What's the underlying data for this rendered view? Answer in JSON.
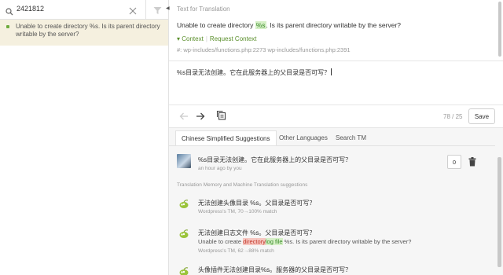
{
  "search": {
    "query": "2421812"
  },
  "strings": [
    {
      "text": "Unable to create directory %s. Is its parent directory writable by the server?"
    }
  ],
  "editor": {
    "section_label": "Text for Translation",
    "source_before": "Unable to create directory ",
    "source_placeholder": "%s",
    "source_after": ". Is its parent directory writable by the server?",
    "context_label": "Context",
    "request_context": "Request Context",
    "references": "#: wp-includes/functions.php:2273 wp-includes/functions.php:2391",
    "translation": "%s目录无法创建。它在此服务器上的父目录是否可写？",
    "counter": "78 / 25",
    "save_label": "Save"
  },
  "tabs": [
    {
      "label": "Chinese Simplified Suggestions"
    },
    {
      "label": "Other Languages"
    },
    {
      "label": "Search TM"
    }
  ],
  "suggestion": {
    "text": "%s目录无法创建。它在此服务器上的父目录是否可写？",
    "meta": "an hour ago by you",
    "votes": "0"
  },
  "tm": {
    "header": "Translation Memory and Machine Translation suggestions",
    "items": [
      {
        "text": "无法创建头像目录 %s。父目录是否可写？",
        "meta": "Wordpress's TM, 70→100% match"
      },
      {
        "text": "无法创建日志文件 %s。父目录是否可写？",
        "orig_before": "Unable to create ",
        "orig_del": "directory",
        "orig_ins": "log file",
        "orig_after": " %s. Is its parent directory writable by the server?",
        "meta": "Wordpress's TM, 62→88% match"
      },
      {
        "text": "头像插件无法创建目录%s。服务器的父目录是否可写？"
      }
    ]
  },
  "colors": {
    "accent_green": "#6eab3e",
    "selected_row": "#f5f0df"
  }
}
